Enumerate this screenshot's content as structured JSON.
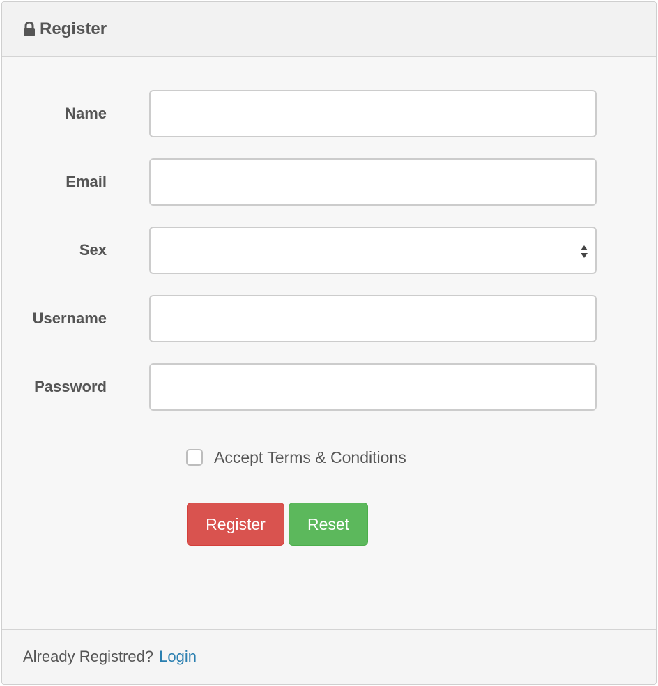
{
  "header": {
    "title": "Register",
    "icon": "lock-icon"
  },
  "form": {
    "fields": [
      {
        "label": "Name",
        "value": "",
        "type": "text"
      },
      {
        "label": "Email",
        "value": "",
        "type": "text"
      },
      {
        "label": "Sex",
        "value": "",
        "type": "select"
      },
      {
        "label": "Username",
        "value": "",
        "type": "text"
      },
      {
        "label": "Password",
        "value": "",
        "type": "password"
      }
    ],
    "terms_label": "Accept Terms & Conditions",
    "terms_checked": false,
    "register_label": "Register",
    "reset_label": "Reset"
  },
  "footer": {
    "text": "Already Registred?",
    "login_label": "Login"
  },
  "colors": {
    "register_button": "#d9534f",
    "reset_button": "#5cb85c",
    "link": "#2a7fb0"
  }
}
